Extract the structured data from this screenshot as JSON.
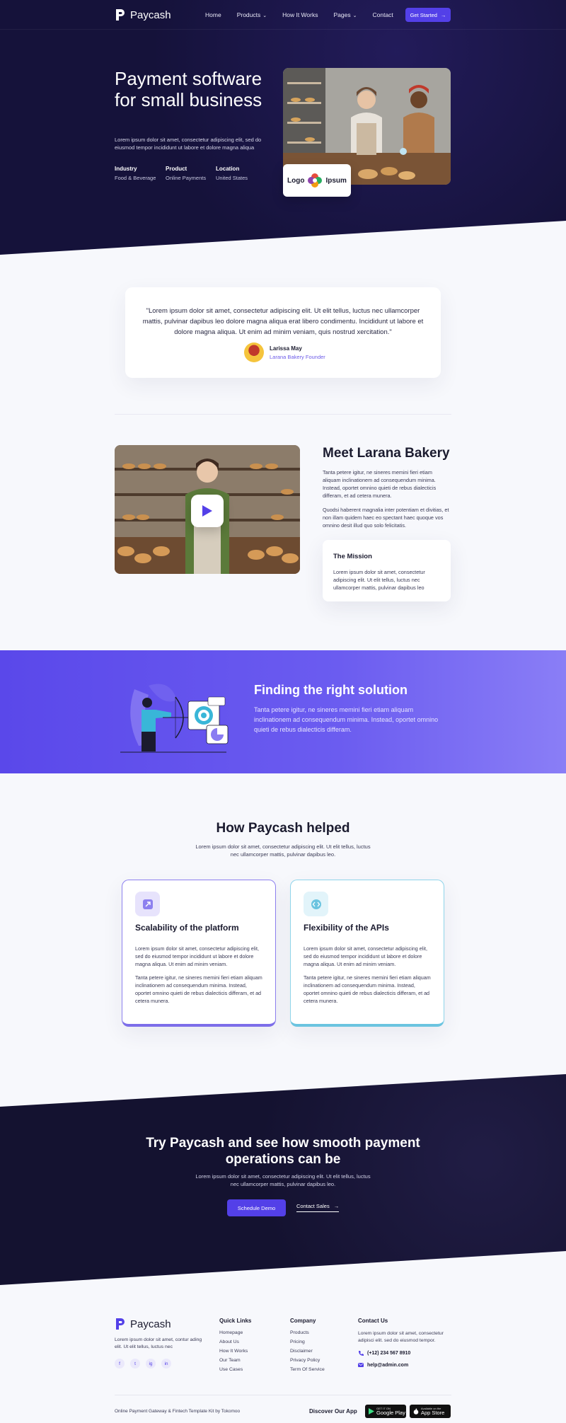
{
  "brand": {
    "name": "Paycash",
    "accent": "#5340e8",
    "dark": "#15123a"
  },
  "nav": {
    "links": [
      {
        "label": "Home"
      },
      {
        "label": "Products",
        "dropdown": true
      },
      {
        "label": "How It Works"
      },
      {
        "label": "Pages",
        "dropdown": true
      },
      {
        "label": "Contact"
      }
    ],
    "cta_label": "Get Started"
  },
  "hero": {
    "title": "Payment software for small business",
    "subtitle": "Lorem ipsum dolor sit amet, consectetur adipiscing elit, sed do eiusmod tempor incididunt ut labore et dolore magna aliqua",
    "meta": [
      {
        "label": "Industry",
        "value": "Food & Beverage"
      },
      {
        "label": "Product",
        "value": "Online Payments"
      },
      {
        "label": "Location",
        "value": "United States"
      }
    ],
    "logo_card": {
      "left": "Logo",
      "right": "Ipsum"
    }
  },
  "testimonial": {
    "quote": "\"Lorem ipsum dolor sit amet, consectetur adipiscing elit. Ut elit tellus, luctus nec ullamcorper mattis, pulvinar dapibus leo dolore magna aliqua erat libero condimentu. Incididunt ut labore et dolore magna aliqua. Ut enim ad minim veniam, quis nostrud xercitation.\"",
    "name": "Larissa May",
    "role": "Larana Bakery Founder"
  },
  "about": {
    "title": "Meet Larana Bakery",
    "p1": "Tanta petere igitur, ne sineres memini fieri etiam aliquam inclinationem ad consequendum minima. Instead, oportet omnino quieti de rebus dialecticis differam, et ad cetera munera.",
    "p2": "Quodsi haberent magnalia inter potentiam et divitias, et non illam quidem haec eo spectant haec quoque vos omnino desit illud quo solo felicitatis.",
    "mission_title": "The Mission",
    "mission_text": "Lorem ipsum dolor sit amet, consectetur adipiscing elit. Ut elit tellus, luctus nec ullamcorper mattis, pulvinar dapibus leo"
  },
  "solution": {
    "title": "Finding the right solution",
    "text": "Tanta petere igitur, ne sineres memini fieri etiam aliquam inclinationem ad consequendum minima. Instead, oportet omnino quieti de rebus dialecticis differam."
  },
  "helped": {
    "title": "How Paycash helped",
    "subtitle": "Lorem ipsum dolor sit amet, consectetur adipiscing elit. Ut elit tellus, luctus nec ullamcorper mattis, pulvinar dapibus leo.",
    "cards": [
      {
        "title": "Scalability of the platform",
        "p1": "Lorem ipsum dolor sit amet, consectetur adipiscing elit, sed do eiusmod tempor incididunt ut labore et dolore magna aliqua. Ut enim ad minim veniam.",
        "p2": "Tanta petere igitur, ne sineres memini fieri etiam aliquam inclinationem ad consequendum minima. Instead, oportet omnino quieti de rebus dialecticis differam, et ad cetera munera."
      },
      {
        "title": "Flexibility of the APIs",
        "p1": "Lorem ipsum dolor sit amet, consectetur adipiscing elit, sed do eiusmod tempor incididunt ut labore et dolore magna aliqua. Ut enim ad minim veniam.",
        "p2": "Tanta petere igitur, ne sineres memini fieri etiam aliquam inclinationem ad consequendum minima. Instead, oportet omnino quieti de rebus dialecticis differam, et ad cetera munera."
      }
    ]
  },
  "cta": {
    "title": "Try Paycash and see how smooth payment operations can be",
    "subtitle": "Lorem ipsum dolor sit amet, consectetur adipiscing elit. Ut elit tellus, luctus nec ullamcorper mattis, pulvinar dapibus leo.",
    "primary": "Schedule Demo",
    "secondary": "Contact Sales"
  },
  "footer": {
    "about": "Lorem ipsum dolor sit amet, contur ading elit. Ut elit tellus, luctus nec",
    "socials": [
      "f",
      "t",
      "ig",
      "in"
    ],
    "quick_links": {
      "title": "Quick Links",
      "items": [
        "Homepage",
        "About Us",
        "How It Works",
        "Our Team",
        "Use Cases"
      ]
    },
    "company": {
      "title": "Company",
      "items": [
        "Products",
        "Pricing",
        "Disclaimer",
        "Privacy Policy",
        "Term Of Service"
      ]
    },
    "contact": {
      "title": "Contact Us",
      "text": "Lorem ipsum dolor sit amet, consectetur adipisci elit. sed do eiusmod tempor.",
      "phone": "(+12) 234 567 8910",
      "email": "help@admin.com"
    },
    "copyright": "Online Payment Gateway & Fintech Template Kit by Tokomoo",
    "discover": "Discover Our App",
    "google_small": "GET IT ON",
    "google_big": "Google Play",
    "apple_small": "Available on the",
    "apple_big": "App Store"
  }
}
